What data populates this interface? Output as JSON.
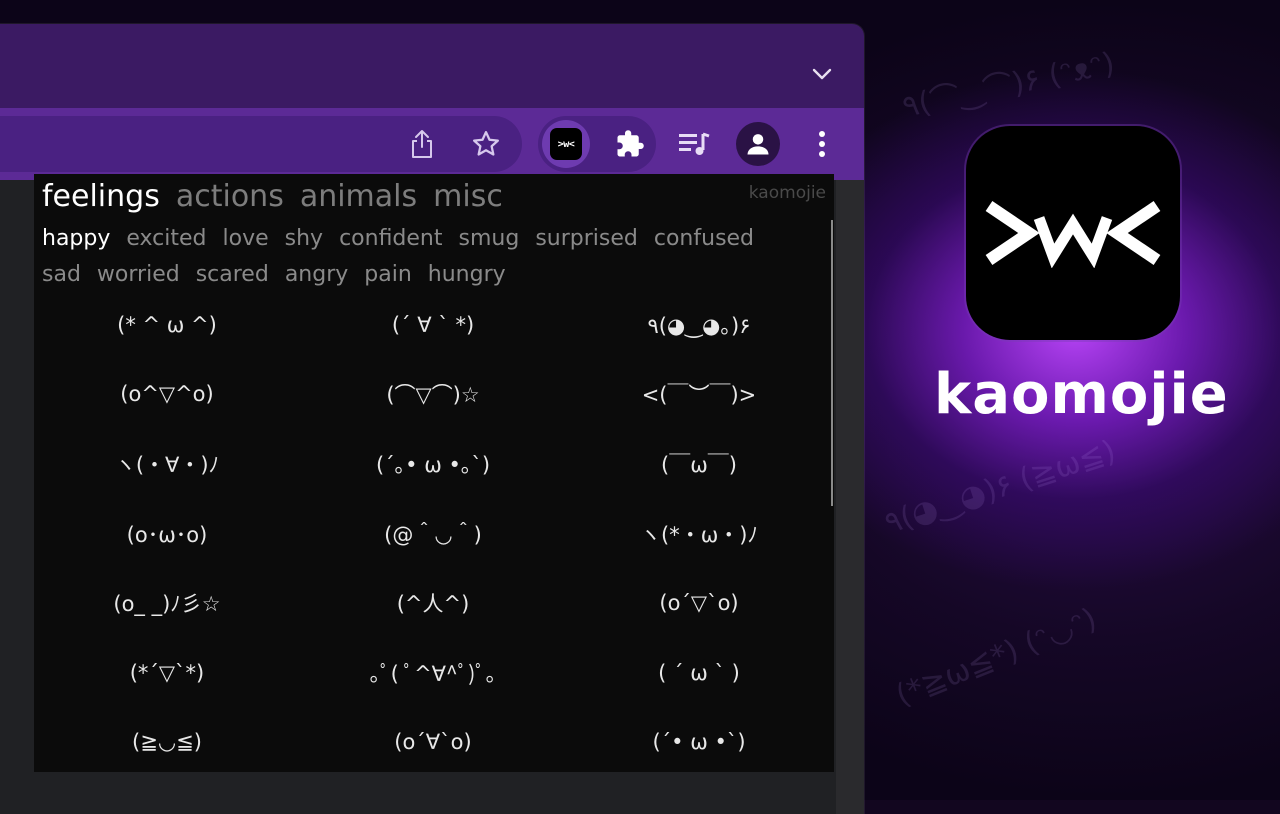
{
  "colors": {
    "titlebar": "#3b1a63",
    "toolbar": "#5c2a96",
    "popup_bg": "#0b0b0b",
    "active_text": "#ffffff",
    "inactive_text": "#7d7d7d"
  },
  "toolbar": {
    "icons": [
      "share-icon",
      "star-icon",
      "kaomojie-extension-icon",
      "extensions-puzzle-icon",
      "media-queue-icon",
      "profile-icon",
      "more-menu-icon"
    ],
    "kaomojie_icon_text": ">w<"
  },
  "popup": {
    "brand": "kaomojie",
    "categories": [
      {
        "label": "feelings",
        "active": true
      },
      {
        "label": "actions",
        "active": false
      },
      {
        "label": "animals",
        "active": false
      },
      {
        "label": "misc",
        "active": false
      }
    ],
    "subcategories": [
      {
        "label": "happy",
        "active": true
      },
      {
        "label": "excited",
        "active": false
      },
      {
        "label": "love",
        "active": false
      },
      {
        "label": "shy",
        "active": false
      },
      {
        "label": "confident",
        "active": false
      },
      {
        "label": "smug",
        "active": false
      },
      {
        "label": "surprised",
        "active": false
      },
      {
        "label": "confused",
        "active": false
      },
      {
        "label": "sad",
        "active": false
      },
      {
        "label": "worried",
        "active": false
      },
      {
        "label": "scared",
        "active": false
      },
      {
        "label": "angry",
        "active": false
      },
      {
        "label": "pain",
        "active": false
      },
      {
        "label": "hungry",
        "active": false
      }
    ],
    "kaomoji": [
      "(* ^ ω ^)",
      "(´ ∀ ` *)",
      "٩(◕‿◕｡)۶",
      "(o^▽^o)",
      "(⌒▽⌒)☆",
      "<(￣︶￣)>",
      "ヽ(・∀・)ﾉ",
      "(´｡• ω •｡`)",
      "(￣ω￣)",
      "(o･ω･o)",
      "(@＾◡＾)",
      "ヽ(*・ω・)ﾉ",
      "(o_ _)ﾉ彡☆",
      "(^人^)",
      "(o´▽`o)",
      "(*´▽`*)",
      "｡ﾟ( ﾟ^∀^ﾟ)ﾟ｡",
      "( ´ ω ` )",
      "(≧◡≦)",
      "(o´∀`o)",
      "(´• ω •`)"
    ]
  },
  "app": {
    "icon_text": ">w<",
    "name": "kaomojie"
  }
}
